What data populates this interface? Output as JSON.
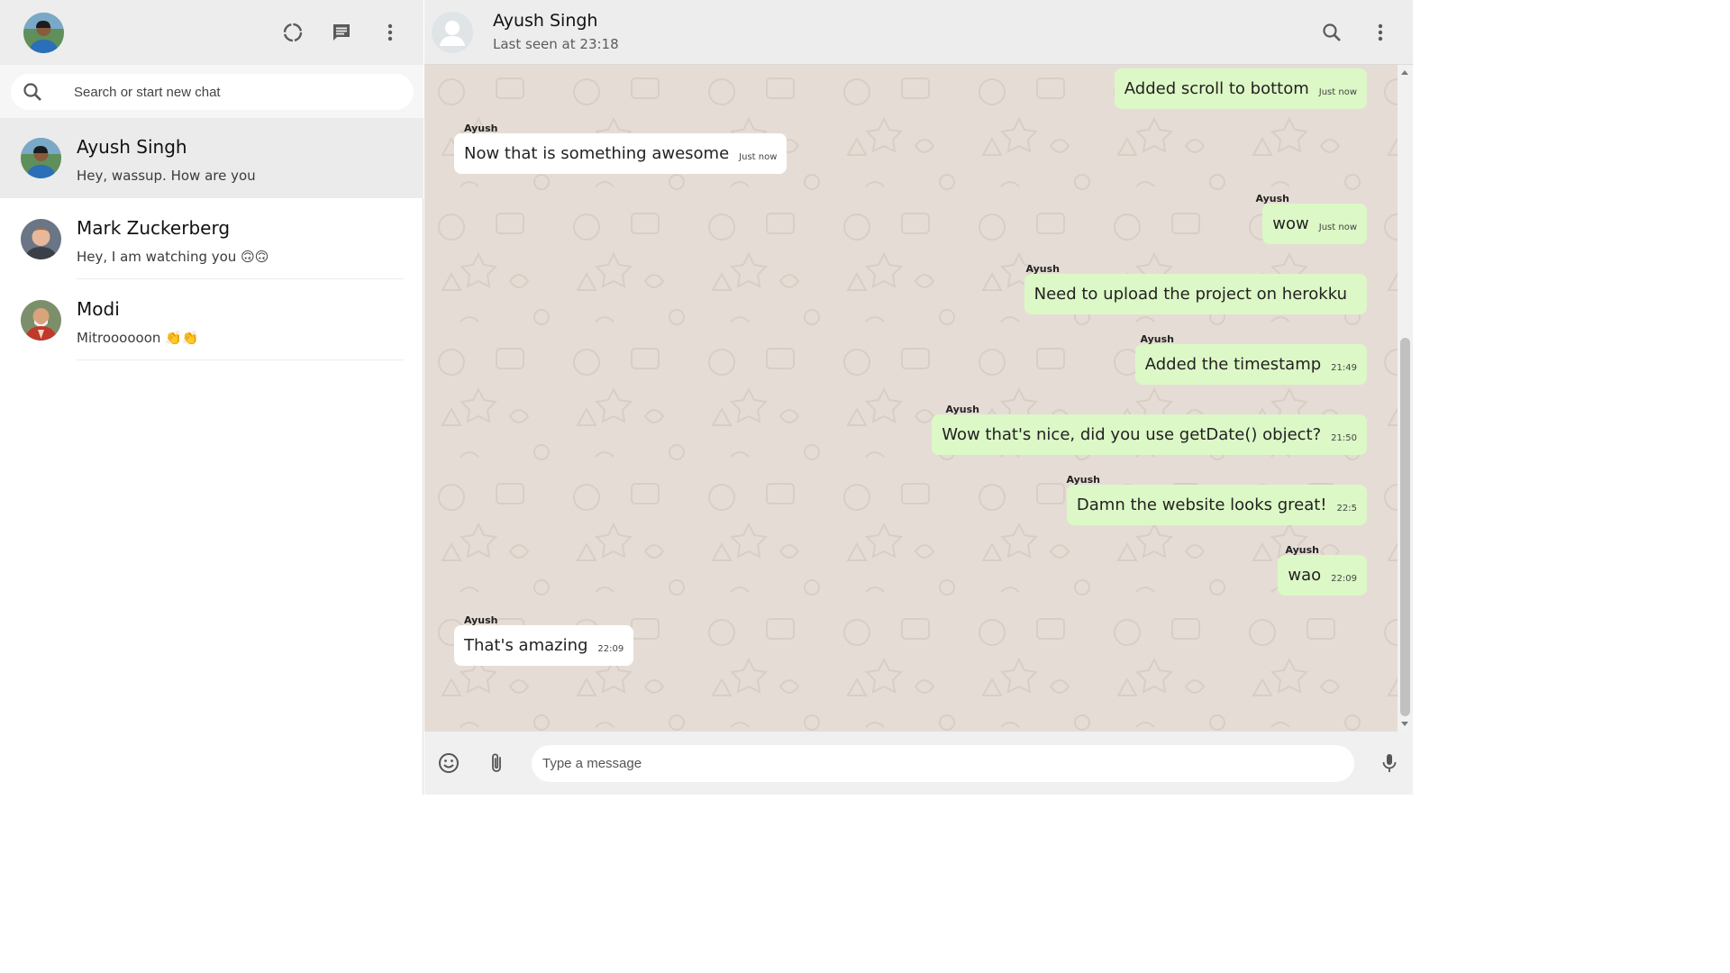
{
  "colors": {
    "header_bg": "#ededed",
    "chat_bg": "#e5ddd5",
    "outgoing_bubble": "#dcf8c6",
    "incoming_bubble": "#ffffff",
    "icon_gray": "#5a5a5a"
  },
  "sidebar": {
    "header_icons": [
      "status-icon",
      "new-chat-icon",
      "more-vert-icon"
    ],
    "search": {
      "placeholder": "Search or start new chat"
    },
    "chats": [
      {
        "name": "Ayush Singh",
        "preview": "Hey, wassup. How are you",
        "active": true
      },
      {
        "name": "Mark Zuckerberg",
        "preview": "Hey, I am watching you 🙃🙃",
        "active": false
      },
      {
        "name": "Modi",
        "preview": "Mitroooooon 👏👏",
        "active": false
      }
    ]
  },
  "conversation": {
    "contact_name": "Ayush Singh",
    "last_seen": "Last seen at 23:18",
    "header_icons": [
      "search-icon",
      "more-vert-icon"
    ],
    "messages": [
      {
        "sender": "",
        "text": "Added scroll to bottom",
        "time": "Just now",
        "outgoing": true
      },
      {
        "sender": "Ayush",
        "text": "Now that is something awesome",
        "time": "Just now",
        "outgoing": false
      },
      {
        "sender": "Ayush",
        "text": "wow",
        "time": "Just now",
        "outgoing": true
      },
      {
        "sender": "Ayush",
        "text": "Need to upload the project on herokku",
        "time": "",
        "outgoing": true
      },
      {
        "sender": "Ayush",
        "text": "Added the timestamp",
        "time": "21:49",
        "outgoing": true
      },
      {
        "sender": "Ayush",
        "text": "Wow that's nice, did you use getDate() object?",
        "time": "21:50",
        "outgoing": true
      },
      {
        "sender": "Ayush",
        "text": "Damn the website looks great!",
        "time": "22:5",
        "outgoing": true
      },
      {
        "sender": "Ayush",
        "text": "wao",
        "time": "22:09",
        "outgoing": true
      },
      {
        "sender": "Ayush",
        "text": "That's amazing",
        "time": "22:09",
        "outgoing": false
      }
    ],
    "composer": {
      "placeholder": "Type a message",
      "icons": [
        "emoji-icon",
        "attach-icon",
        "mic-icon"
      ]
    }
  }
}
